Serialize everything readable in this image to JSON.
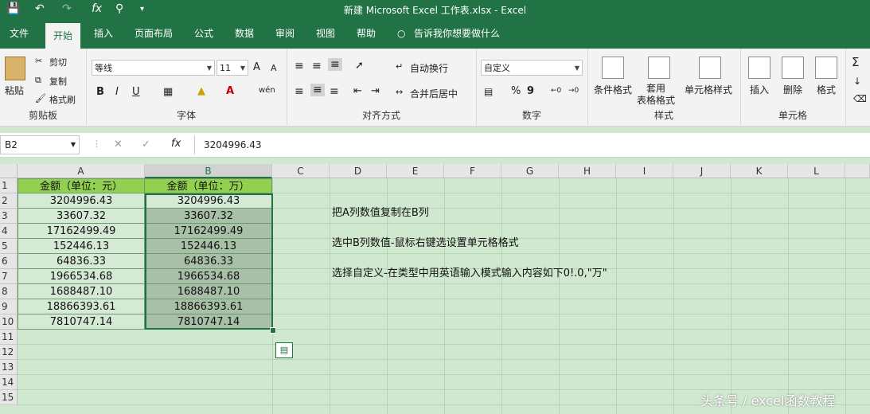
{
  "title_bar": {
    "title": "新建 Microsoft Excel 工作表.xlsx  -  Excel"
  },
  "quick_access": {
    "save_icon": "save-icon",
    "undo_icon": "undo-icon",
    "redo_icon": "redo-icon",
    "fx_label": "fx",
    "search_icon": "search-icon"
  },
  "tabs": [
    "文件",
    "开始",
    "插入",
    "页面布局",
    "公式",
    "数据",
    "审阅",
    "视图",
    "帮助"
  ],
  "tell_me": "告诉我你想要做什么",
  "ribbon": {
    "clipboard": {
      "paste": "粘贴",
      "cut": "剪切",
      "copy": "复制",
      "format_painter": "格式刷",
      "label": "剪贴板"
    },
    "font": {
      "font_name": "等线",
      "font_size": "11",
      "grow": "A",
      "shrink": "A",
      "bold": "B",
      "italic": "I",
      "underline": "U",
      "wen": "wén",
      "label": "字体"
    },
    "alignment": {
      "wrap": "自动换行",
      "merge": "合并后居中",
      "label": "对齐方式"
    },
    "number": {
      "format": "自定义",
      "percent": "%",
      "comma": "9",
      "label": "数字"
    },
    "styles": {
      "conditional": "条件格式",
      "table_format": "套用\n表格格式",
      "cell_styles": "单元格样式",
      "label": "样式"
    },
    "cells": {
      "insert": "插入",
      "delete": "删除",
      "format": "格式",
      "label": "单元格"
    }
  },
  "formula_bar": {
    "name_box": "B2",
    "cancel": "✕",
    "enter": "✓",
    "fx": "fx",
    "value": "3204996.43"
  },
  "columns": [
    "A",
    "B",
    "C",
    "D",
    "E",
    "F",
    "G",
    "H",
    "I",
    "J",
    "K",
    "L"
  ],
  "rows": [
    "1",
    "2",
    "3",
    "4",
    "5",
    "6",
    "7",
    "8",
    "9",
    "10",
    "11",
    "12",
    "13",
    "14",
    "15"
  ],
  "header_a": "金额（单位：元）",
  "header_b": "金额（单位：万）",
  "values": [
    "3204996.43",
    "33607.32",
    "17162499.49",
    "152446.13",
    "64836.33",
    "1966534.68",
    "1688487.10",
    "18866393.61",
    "7810747.14"
  ],
  "notes": [
    "把A列数值复制在B列",
    "选中B列数值-鼠标右键选设置单元格格式",
    "选择自定义-在类型中用英语输入模式输入内容如下0!.0,\"万\""
  ],
  "watermark": "头条号 / excel函数教程",
  "colors": {
    "excel_green": "#217346",
    "header_fill": "#92d050",
    "sheet_bg": "#cfe8cf"
  }
}
